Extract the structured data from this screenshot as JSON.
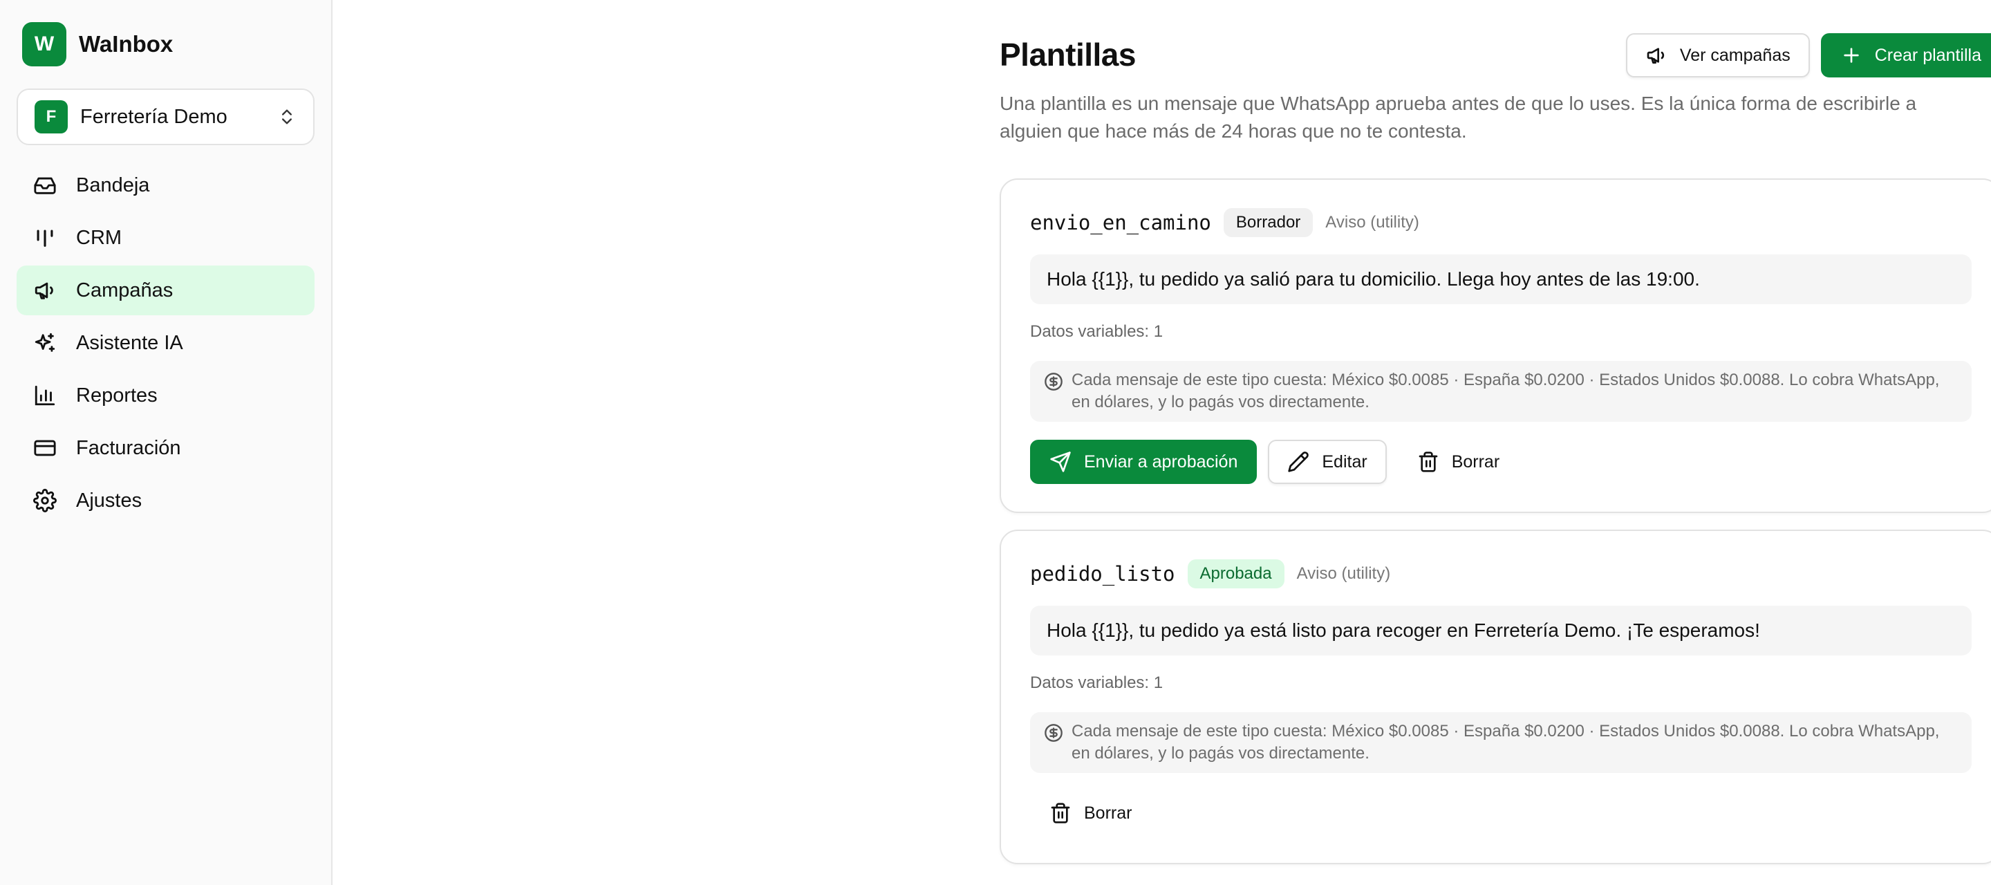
{
  "brand": {
    "initial": "W",
    "name": "WaInbox"
  },
  "workspace": {
    "initial": "F",
    "name": "Ferretería Demo"
  },
  "nav": [
    {
      "label": "Bandeja",
      "icon": "inbox-icon"
    },
    {
      "label": "CRM",
      "icon": "kanban-icon"
    },
    {
      "label": "Campañas",
      "icon": "megaphone-icon",
      "active": true
    },
    {
      "label": "Asistente IA",
      "icon": "sparkles-icon"
    },
    {
      "label": "Reportes",
      "icon": "bar-chart-icon"
    },
    {
      "label": "Facturación",
      "icon": "credit-card-icon"
    },
    {
      "label": "Ajustes",
      "icon": "gear-icon"
    }
  ],
  "header": {
    "title": "Plantillas",
    "view_campaigns": "Ver campañas",
    "create_template": "Crear plantilla",
    "description": "Una plantilla es un mensaje que WhatsApp aprueba antes de que lo uses. Es la única forma de escribirle a alguien que hace más de 24 horas que no te contesta."
  },
  "templates": [
    {
      "name": "envio_en_camino",
      "status": "Borrador",
      "category": "Aviso (utility)",
      "message": "Hola {{1}}, tu pedido ya salió para tu domicilio. Llega hoy antes de las 19:00.",
      "variables": "Datos variables: 1",
      "cost": "Cada mensaje de este tipo cuesta: México $0.0085 · España $0.0200 · Estados Unidos $0.0088. Lo cobra WhatsApp, en dólares, y lo pagás vos directamente.",
      "send_label": "Enviar a aprobación",
      "edit_label": "Editar",
      "delete_label": "Borrar"
    },
    {
      "name": "pedido_listo",
      "status": "Aprobada",
      "category": "Aviso (utility)",
      "message": "Hola {{1}}, tu pedido ya está listo para recoger en Ferretería Demo. ¡Te esperamos!",
      "variables": "Datos variables: 1",
      "cost": "Cada mensaje de este tipo cuesta: México $0.0085 · España $0.0200 · Estados Unidos $0.0088. Lo cobra WhatsApp, en dólares, y lo pagás vos directamente.",
      "delete_label": "Borrar"
    }
  ],
  "colors": {
    "accent": "#0a8a3c",
    "active_nav_bg": "#ddfbe6",
    "approved_badge_bg": "#dbfae4"
  }
}
